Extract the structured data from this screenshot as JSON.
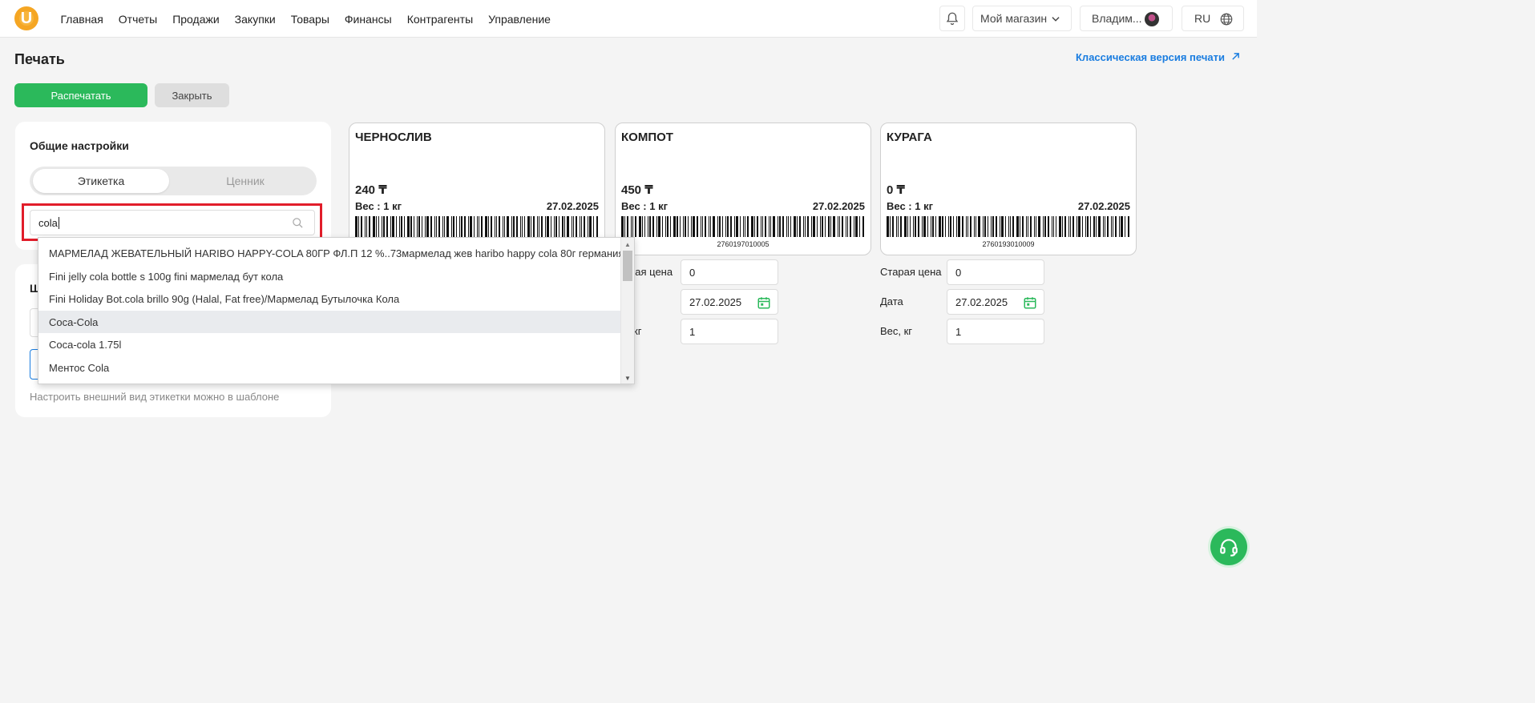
{
  "nav": {
    "logo_letter": "U",
    "items": [
      "Главная",
      "Отчеты",
      "Продажи",
      "Закупки",
      "Товары",
      "Финансы",
      "Контрагенты",
      "Управление"
    ],
    "store": "Мой магазин",
    "user": "Владим...",
    "lang": "RU"
  },
  "page": {
    "title": "Печать",
    "classic_link": "Классическая версия печати",
    "print_button": "Распечатать",
    "close_button": "Закрыть"
  },
  "settings": {
    "title": "Общие настройки",
    "tabs": [
      "Этикетка",
      "Ценник"
    ],
    "active_tab": "Этикетка",
    "search_value": "cola",
    "second_card_partial_title": "Ш",
    "hint": "Настроить внешний вид этикетки можно в шаблоне"
  },
  "dropdown": {
    "items": [
      "МАРМЕЛАД ЖЕВАТЕЛЬНЫЙ HARIBO HAPPY-COLA 80ГР ФЛ.П 12 %..73мармелад жев haribo happy cola 80г германия",
      "Fini jelly cola bottle s 100g fini мармелад бут кола",
      "Fini Holiday Bot.cola brillo 90g (Halal, Fat free)/Мармелад Бутылочка Кола",
      "Coca-Cola",
      "Coca-cola 1.75l",
      "Ментос Cola"
    ],
    "hovered_index": 3
  },
  "labels": [
    {
      "name": "ЧЕРНОСЛИВ",
      "price": "240 ₸",
      "weight": "Вес : 1 кг",
      "date": "27.02.2025",
      "code": ""
    },
    {
      "name": "КОМПОТ",
      "price": "450 ₸",
      "weight": "Вес : 1 кг",
      "date": "27.02.2025",
      "code": "2760197010005"
    },
    {
      "name": "КУРАГА",
      "price": "0 ₸",
      "weight": "Вес : 1 кг",
      "date": "27.02.2025",
      "code": "2760193010009"
    }
  ],
  "fields": {
    "col2": {
      "old_price_label": "ярая цена",
      "old_price": "0",
      "date_label": "а",
      "date": "27.02.2025",
      "weight_label": "кг",
      "weight": "1"
    },
    "col3": {
      "old_price_label": "Старая цена",
      "old_price": "0",
      "date_label": "Дата",
      "date": "27.02.2025",
      "weight_label": "Вес, кг",
      "weight": "1"
    }
  },
  "colors": {
    "accent_green": "#2bb95b",
    "link_blue": "#1a7de0",
    "highlight_red": "#e11d2a",
    "logo_orange": "#f5a623"
  }
}
